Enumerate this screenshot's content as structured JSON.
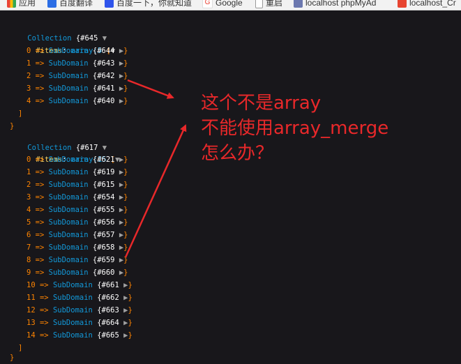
{
  "bookmarks": [
    {
      "label": "应用",
      "icon": "apps-grid-icon",
      "color": "#4285f4"
    },
    {
      "label": "百度翻译",
      "icon": "baidu-translate-icon",
      "color": "#2b6de5"
    },
    {
      "label": "百度一下，你就知道",
      "icon": "baidu-paw-icon",
      "color": "#2f54eb"
    },
    {
      "label": "Google",
      "icon": "google-icon",
      "color": "#ea4335"
    },
    {
      "label": "重启",
      "icon": "page-icon",
      "color": "#ffffff"
    },
    {
      "label": "localhost phpMyAd",
      "icon": "phpmyadmin-icon",
      "color": "#6c78af"
    },
    {
      "label": "localhost_Cr",
      "icon": "laravel-icon",
      "color": "#e74430"
    }
  ],
  "dumps": [
    {
      "class": "Collection",
      "object_id": "{#645",
      "toggle": "▼",
      "items_label": "#items",
      "items_meta": "array:5",
      "open_bracket": "[",
      "entries": [
        {
          "index": "0",
          "class": "SubDomain",
          "object_id": "{#644"
        },
        {
          "index": "1",
          "class": "SubDomain",
          "object_id": "{#643"
        },
        {
          "index": "2",
          "class": "SubDomain",
          "object_id": "{#642"
        },
        {
          "index": "3",
          "class": "SubDomain",
          "object_id": "{#641"
        },
        {
          "index": "4",
          "class": "SubDomain",
          "object_id": "{#640"
        }
      ],
      "close_bracket": "]",
      "close_brace": "}"
    },
    {
      "class": "Collection",
      "object_id": "{#617",
      "toggle": "▼",
      "items_label": "#items",
      "items_meta": "array:15",
      "open_bracket": "[",
      "entries": [
        {
          "index": "0",
          "class": "SubDomain",
          "object_id": "{#621"
        },
        {
          "index": "1",
          "class": "SubDomain",
          "object_id": "{#619"
        },
        {
          "index": "2",
          "class": "SubDomain",
          "object_id": "{#615"
        },
        {
          "index": "3",
          "class": "SubDomain",
          "object_id": "{#654"
        },
        {
          "index": "4",
          "class": "SubDomain",
          "object_id": "{#655"
        },
        {
          "index": "5",
          "class": "SubDomain",
          "object_id": "{#656"
        },
        {
          "index": "6",
          "class": "SubDomain",
          "object_id": "{#657"
        },
        {
          "index": "7",
          "class": "SubDomain",
          "object_id": "{#658"
        },
        {
          "index": "8",
          "class": "SubDomain",
          "object_id": "{#659"
        },
        {
          "index": "9",
          "class": "SubDomain",
          "object_id": "{#660"
        },
        {
          "index": "10",
          "class": "SubDomain",
          "object_id": "{#661"
        },
        {
          "index": "11",
          "class": "SubDomain",
          "object_id": "{#662"
        },
        {
          "index": "12",
          "class": "SubDomain",
          "object_id": "{#663"
        },
        {
          "index": "13",
          "class": "SubDomain",
          "object_id": "{#664"
        },
        {
          "index": "14",
          "class": "SubDomain",
          "object_id": "{#665"
        }
      ],
      "close_bracket": "]",
      "close_brace": "}"
    }
  ],
  "symbols": {
    "arrow": "=>",
    "expand": "▶",
    "brace_close": "}"
  },
  "annotation": {
    "lines": [
      "这个不是array",
      "不能使用array_merge",
      "怎么办？"
    ],
    "color": "#e8282a"
  }
}
